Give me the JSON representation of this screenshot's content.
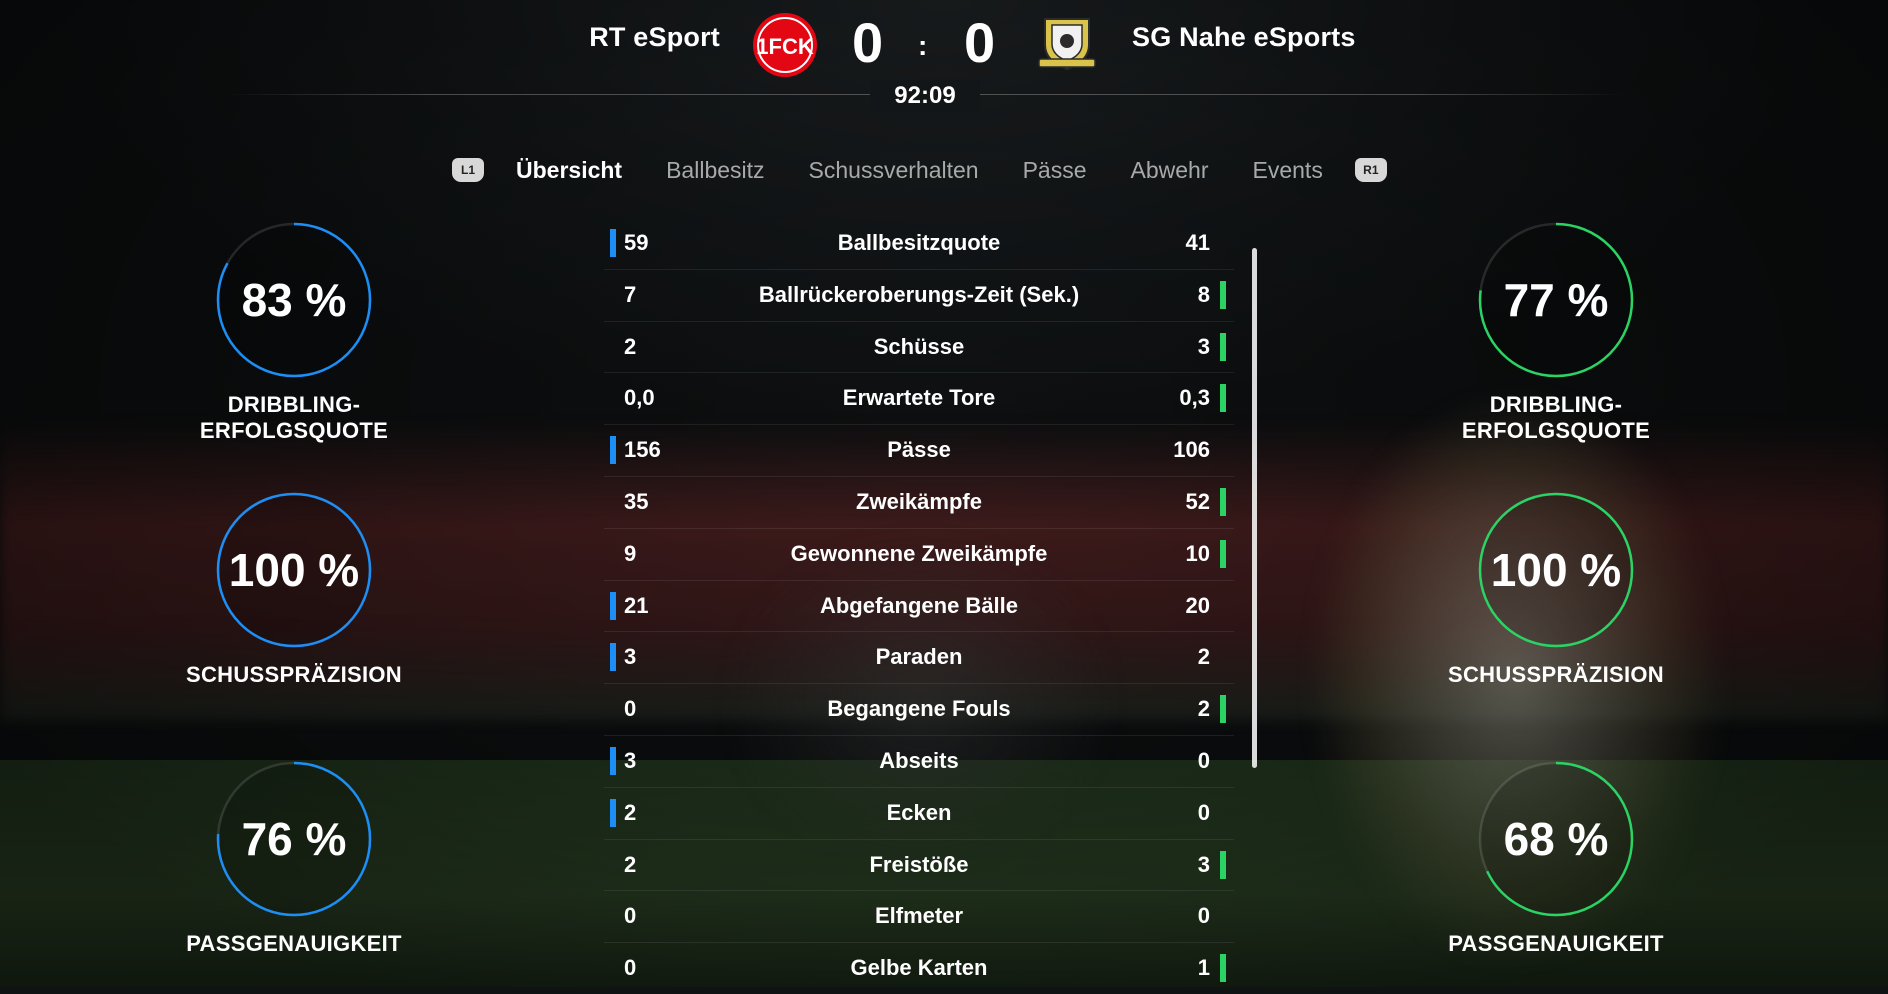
{
  "match": {
    "home_team": "RT eSport",
    "away_team": "SG Nahe eSports",
    "home_score": "0",
    "separator": ":",
    "away_score": "0",
    "clock": "92:09",
    "home_crest_text": "1FCK",
    "colors": {
      "home": "#1c8ef5",
      "away": "#2ad363",
      "home_crest": "#e30613"
    }
  },
  "tabs": {
    "left_bumper": "L1",
    "right_bumper": "R1",
    "items": [
      "Übersicht",
      "Ballbesitz",
      "Schussverhalten",
      "Pässe",
      "Abwehr",
      "Events"
    ],
    "active": "Übersicht"
  },
  "gauges": {
    "home": [
      {
        "value": "83 %",
        "label": "DRIBBLING-ERFOLGSQUOTE",
        "percent": 83
      },
      {
        "value": "100 %",
        "label": "SCHUSSPRÄZISION",
        "percent": 100
      },
      {
        "value": "76 %",
        "label": "PASSGENAUIGKEIT",
        "percent": 76
      }
    ],
    "away": [
      {
        "value": "77 %",
        "label": "DRIBBLING-ERFOLGSQUOTE",
        "percent": 77
      },
      {
        "value": "100 %",
        "label": "SCHUSSPRÄZISION",
        "percent": 100
      },
      {
        "value": "68 %",
        "label": "PASSGENAUIGKEIT",
        "percent": 68
      }
    ]
  },
  "stats": [
    {
      "label": "Ballbesitzquote",
      "home": "59",
      "away": "41",
      "leader": "home"
    },
    {
      "label": "Ballrückeroberungs-Zeit (Sek.)",
      "home": "7",
      "away": "8",
      "leader": "away"
    },
    {
      "label": "Schüsse",
      "home": "2",
      "away": "3",
      "leader": "away"
    },
    {
      "label": "Erwartete Tore",
      "home": "0,0",
      "away": "0,3",
      "leader": "away"
    },
    {
      "label": "Pässe",
      "home": "156",
      "away": "106",
      "leader": "home"
    },
    {
      "label": "Zweikämpfe",
      "home": "35",
      "away": "52",
      "leader": "away"
    },
    {
      "label": "Gewonnene Zweikämpfe",
      "home": "9",
      "away": "10",
      "leader": "away"
    },
    {
      "label": "Abgefangene Bälle",
      "home": "21",
      "away": "20",
      "leader": "home"
    },
    {
      "label": "Paraden",
      "home": "3",
      "away": "2",
      "leader": "home"
    },
    {
      "label": "Begangene Fouls",
      "home": "0",
      "away": "2",
      "leader": "away"
    },
    {
      "label": "Abseits",
      "home": "3",
      "away": "0",
      "leader": "home"
    },
    {
      "label": "Ecken",
      "home": "2",
      "away": "0",
      "leader": "home"
    },
    {
      "label": "Freistöße",
      "home": "2",
      "away": "3",
      "leader": "away"
    },
    {
      "label": "Elfmeter",
      "home": "0",
      "away": "0",
      "leader": "none"
    },
    {
      "label": "Gelbe Karten",
      "home": "0",
      "away": "1",
      "leader": "away"
    }
  ]
}
